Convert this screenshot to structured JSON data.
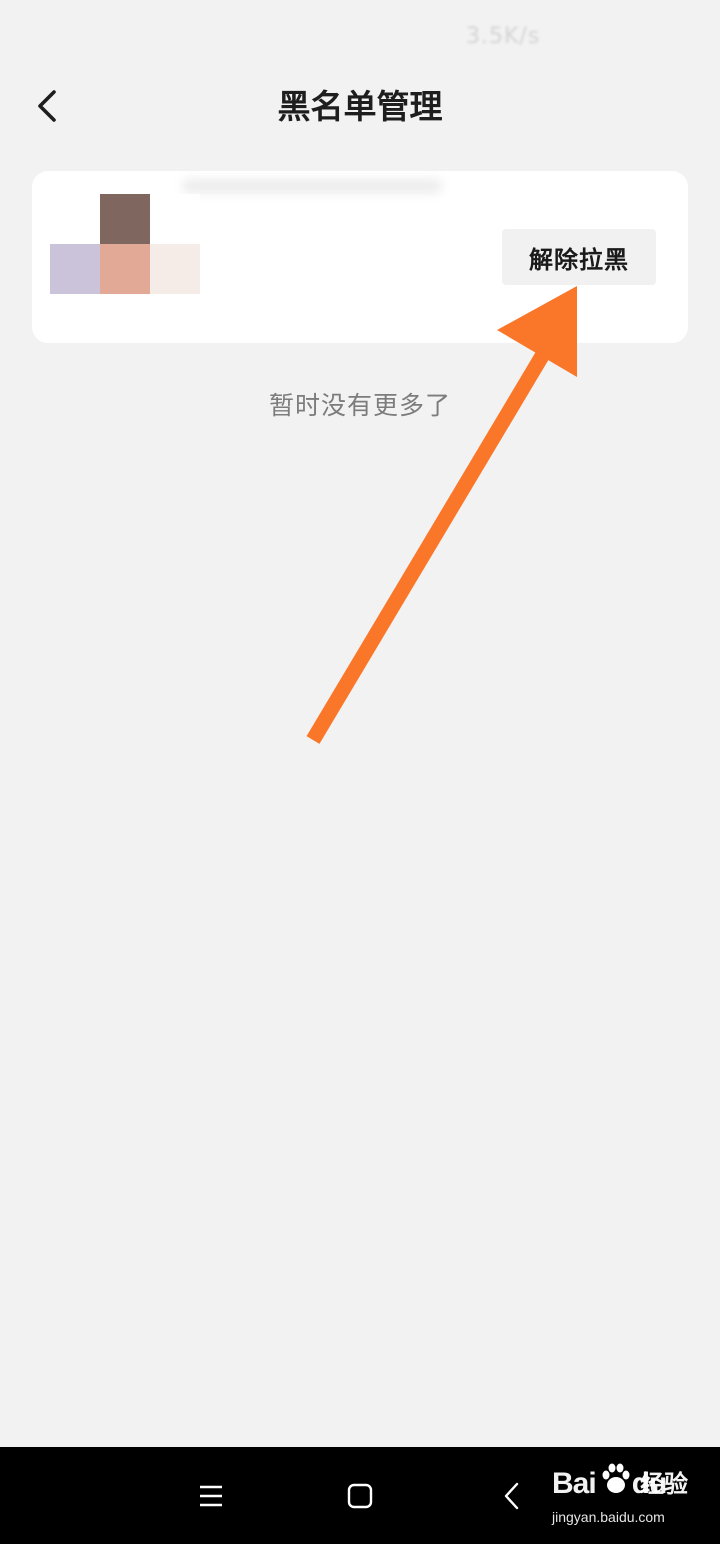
{
  "status_bar": {
    "speed_text": "3.5K/s"
  },
  "header": {
    "back_icon": "chevron-left-icon",
    "title": "黑名单管理"
  },
  "blacklist": {
    "items": [
      {
        "avatar_colors": [
          "#ffffff",
          "#7f675f",
          "#cbc3d9",
          "#e2a997",
          "#f5ece8",
          "#ffffff"
        ],
        "unblock_label": "解除拉黑"
      }
    ],
    "end_text": "暂时没有更多了"
  },
  "annotation": {
    "arrow_color": "#fa7628",
    "arrow_target": "解除拉黑"
  },
  "system_nav": {
    "menu_icon": "menu-icon",
    "home_icon": "home-square-icon",
    "back_icon": "back-chevron-icon"
  },
  "watermark": {
    "brand": "Bai",
    "brand_suffix": "du",
    "product": "经验",
    "url": "jingyan.baidu.com"
  }
}
